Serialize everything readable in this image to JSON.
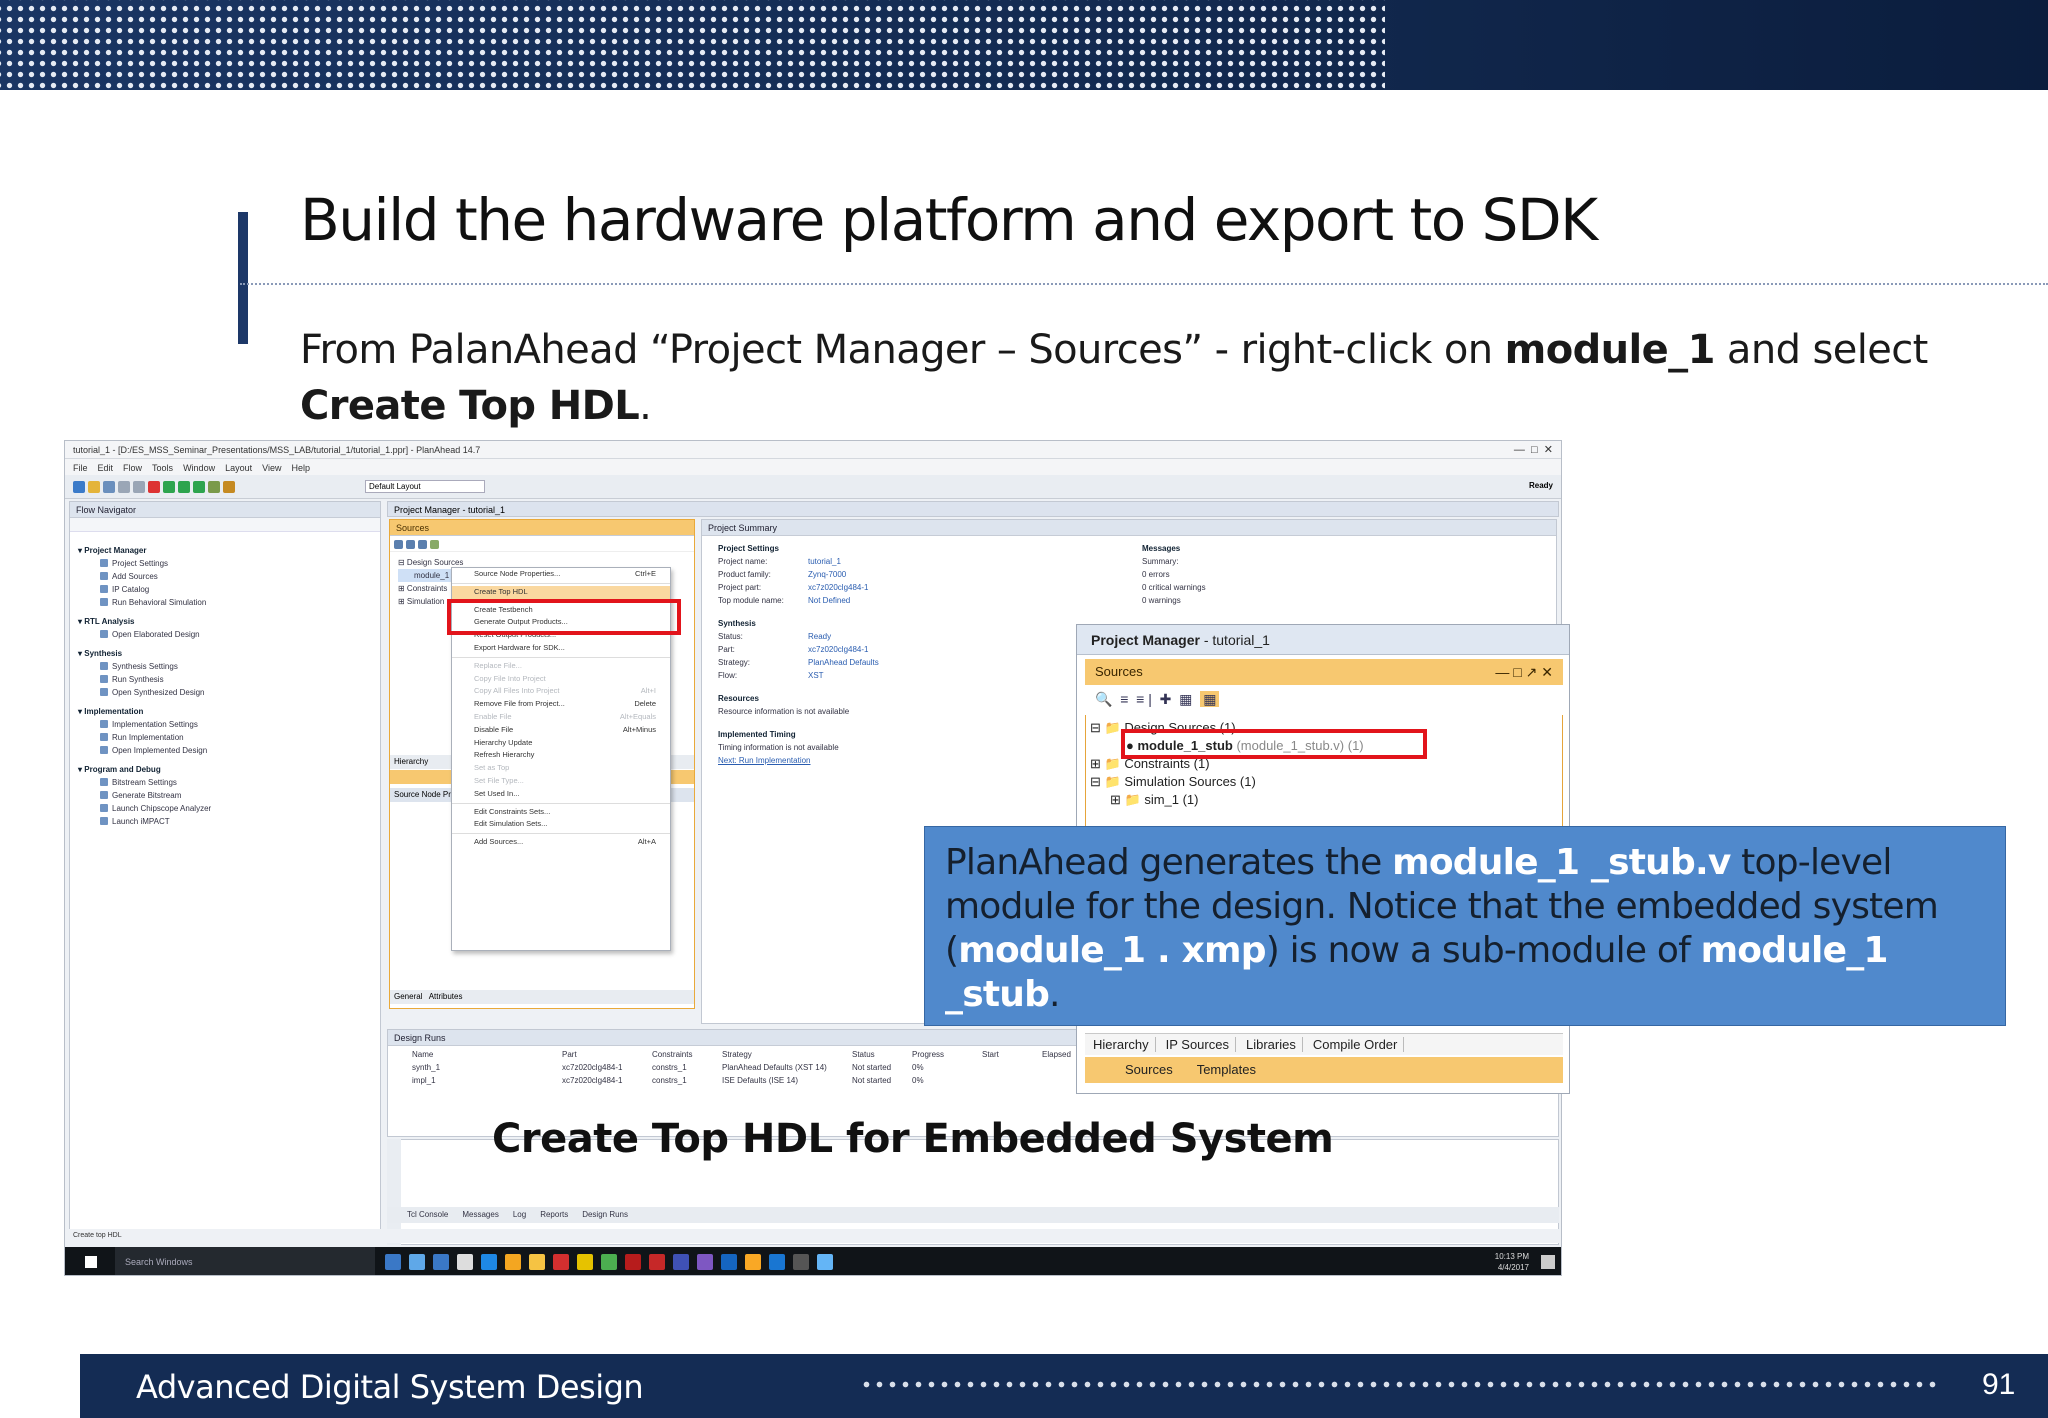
{
  "slide": {
    "title": "Build the hardware platform and export to SDK",
    "subtitle_1": "From PalanAhead “Project Manager – Sources” - right-click on ",
    "subtitle_bold_1": "module_1",
    "subtitle_2": " and select",
    "subtitle_bold_2": "Create Top HDL",
    "subtitle_3": ".",
    "caption": "Create Top HDL for Embedded System",
    "footer": "Advanced Digital System Design",
    "page_number": "91"
  },
  "callout": {
    "t1": "PlanAhead generates the ",
    "b1": "module_1 _stub.v",
    "t2": " top-level module for the design. Notice that the embedded system (",
    "b2": "module_1 . xmp",
    "t3": ") is now a sub-module of ",
    "b3": "module_1 _stub",
    "t4": "."
  },
  "screenshot": {
    "window_title": "tutorial_1 - [D:/ES_MSS_Seminar_Presentations/MSS_LAB/tutorial_1/tutorial_1.ppr] - PlanAhead 14.7",
    "menu": [
      "File",
      "Edit",
      "Flow",
      "Tools",
      "Window",
      "Layout",
      "View",
      "Help"
    ],
    "layout_select": "Default Layout",
    "status_right": "Ready",
    "flow_navigator": {
      "header": "Flow Navigator",
      "items": [
        {
          "label": "Project Manager",
          "head": true
        },
        {
          "label": "Project Settings",
          "head": false
        },
        {
          "label": "Add Sources",
          "head": false
        },
        {
          "label": "IP Catalog",
          "head": false
        },
        {
          "label": "Run Behavioral Simulation",
          "head": false
        },
        {
          "label": "RTL Analysis",
          "head": true
        },
        {
          "label": "Open Elaborated Design",
          "head": false
        },
        {
          "label": "Synthesis",
          "head": true
        },
        {
          "label": "Synthesis Settings",
          "head": false
        },
        {
          "label": "Run Synthesis",
          "head": false
        },
        {
          "label": "Open Synthesized Design",
          "head": false
        },
        {
          "label": "Implementation",
          "head": true
        },
        {
          "label": "Implementation Settings",
          "head": false
        },
        {
          "label": "Run Implementation",
          "head": false
        },
        {
          "label": "Open Implemented Design",
          "head": false
        },
        {
          "label": "Program and Debug",
          "head": true
        },
        {
          "label": "Bitstream Settings",
          "head": false
        },
        {
          "label": "Generate Bitstream",
          "head": false
        },
        {
          "label": "Launch Chipscope Analyzer",
          "head": false
        },
        {
          "label": "Launch iMPACT",
          "head": false
        }
      ]
    },
    "project_manager_header": "Project Manager - tutorial_1",
    "sources_header": "Sources",
    "summary_tab": "Project Summary",
    "summary": {
      "settings_header": "Project Settings",
      "rows": [
        [
          "Project name:",
          "tutorial_1"
        ],
        [
          "Product family:",
          "Zynq-7000"
        ],
        [
          "Project part:",
          "xc7z020clg484-1"
        ],
        [
          "Top module name:",
          "Not Defined"
        ]
      ],
      "synthesis_header": "Synthesis",
      "synth_rows": [
        [
          "Status:",
          "Ready"
        ],
        [
          "Part:",
          "xc7z020clg484-1"
        ],
        [
          "Strategy:",
          "PlanAhead Defaults"
        ],
        [
          "Flow:",
          "XST"
        ]
      ],
      "resources_header": "Resources",
      "resources_text": "Resource information is not available",
      "timing_header": "Implemented Timing",
      "timing_text": "Timing information is not available",
      "timing_next": "Next: Run Implementation",
      "messages_header": "Messages",
      "messages": [
        "Summary:",
        "0 errors",
        "0 critical warnings",
        "0 warnings"
      ]
    },
    "context_menu": [
      {
        "label": "Source Node Properties...",
        "shortcut": "Ctrl+E",
        "dim": false,
        "sel": false
      },
      {
        "label": "",
        "shortcut": "",
        "dim": false,
        "sel": false
      },
      {
        "label": "Create Top HDL",
        "shortcut": "",
        "dim": false,
        "sel": true
      },
      {
        "label": "",
        "shortcut": "",
        "dim": false,
        "sel": false
      },
      {
        "label": "Create Testbench",
        "shortcut": "",
        "dim": false,
        "sel": false
      },
      {
        "label": "Generate Output Products...",
        "shortcut": "",
        "dim": false,
        "sel": false
      },
      {
        "label": "Reset Output Products...",
        "shortcut": "",
        "dim": false,
        "sel": false
      },
      {
        "label": "Export Hardware for SDK...",
        "shortcut": "",
        "dim": false,
        "sel": false
      },
      {
        "label": "",
        "shortcut": "",
        "dim": false,
        "sel": false
      },
      {
        "label": "Replace File...",
        "shortcut": "",
        "dim": true,
        "sel": false
      },
      {
        "label": "Copy File Into Project",
        "shortcut": "",
        "dim": true,
        "sel": false
      },
      {
        "label": "Copy All Files Into Project",
        "shortcut": "Alt+I",
        "dim": true,
        "sel": false
      },
      {
        "label": "Remove File from Project...",
        "shortcut": "Delete",
        "dim": false,
        "sel": false
      },
      {
        "label": "Enable File",
        "shortcut": "Alt+Equals",
        "dim": true,
        "sel": false
      },
      {
        "label": "Disable File",
        "shortcut": "Alt+Minus",
        "dim": false,
        "sel": false
      },
      {
        "label": "Hierarchy Update",
        "shortcut": "",
        "dim": false,
        "sel": false
      },
      {
        "label": "Refresh Hierarchy",
        "shortcut": "",
        "dim": false,
        "sel": false
      },
      {
        "label": "Set as Top",
        "shortcut": "",
        "dim": true,
        "sel": false
      },
      {
        "label": "Set File Type...",
        "shortcut": "",
        "dim": true,
        "sel": false
      },
      {
        "label": "Set Used In...",
        "shortcut": "",
        "dim": false,
        "sel": false
      },
      {
        "label": "",
        "shortcut": "",
        "dim": false,
        "sel": false
      },
      {
        "label": "Edit Constraints Sets...",
        "shortcut": "",
        "dim": false,
        "sel": false
      },
      {
        "label": "Edit Simulation Sets...",
        "shortcut": "",
        "dim": false,
        "sel": false
      },
      {
        "label": "",
        "shortcut": "",
        "dim": false,
        "sel": false
      },
      {
        "label": "Add Sources...",
        "shortcut": "Alt+A",
        "dim": false,
        "sel": false
      }
    ],
    "design_runs_header": "Design Runs",
    "design_runs_cols": [
      "Name",
      "Part",
      "Constraints",
      "Strategy",
      "Status",
      "Progress",
      "Start",
      "Elapsed"
    ],
    "design_runs_rows": [
      [
        "synth_1",
        "xc7z020clg484-1",
        "constrs_1",
        "PlanAhead Defaults (XST 14)",
        "Not started",
        "0%"
      ],
      [
        "impl_1",
        "xc7z020clg484-1",
        "constrs_1",
        "ISE Defaults (ISE 14)",
        "Not started",
        "0%"
      ]
    ],
    "bottom_tabs": [
      "Tcl Console",
      "Messages",
      "Log",
      "Reports",
      "Design Runs"
    ],
    "status_text": "Create top HDL",
    "taskbar_search": "Search Windows",
    "taskbar_time": "10:13 PM",
    "taskbar_date": "4/4/2017"
  },
  "inset": {
    "pm_header_bold": "Project Manager",
    "pm_header_rest": " - tutorial_1",
    "sources": "Sources",
    "tree": {
      "design_sources": "Design Sources (1)",
      "module": "module_1_stub",
      "module_file": "(module_1_stub.v) (1)",
      "constraints": "Constraints (1)",
      "sim_sources": "Simulation Sources (1)",
      "sim_1": "sim_1 (1)"
    },
    "tabs": [
      "Hierarchy",
      "IP Sources",
      "Libraries",
      "Compile Order"
    ],
    "tabs2": [
      "Sources",
      "Templates"
    ]
  },
  "colors": {
    "header_navy": "#142c54",
    "callout_blue": "#5089cc",
    "highlight_red": "#e2141b",
    "sources_orange": "#f7c870"
  }
}
